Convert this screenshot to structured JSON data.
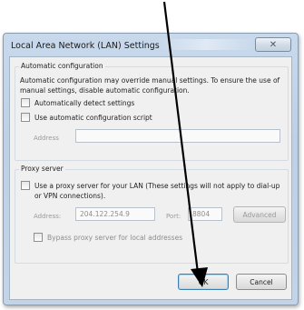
{
  "dialog": {
    "title": "Local Area Network (LAN) Settings",
    "close_symbol": "✕"
  },
  "auto_config": {
    "group_label": "Automatic configuration",
    "description": "Automatic configuration may override manual settings.  To ensure the use of manual settings, disable automatic configuration.",
    "detect_label": "Automatically detect settings",
    "script_label": "Use automatic configuration script",
    "address_label": "Address",
    "address_value": ""
  },
  "proxy": {
    "group_label": "Proxy server",
    "use_proxy_label": "Use a proxy server for your LAN (These settings will not apply to dial-up or VPN connections).",
    "address_label": "Address:",
    "address_value": "204.122.254.9",
    "port_label": "Port:",
    "port_value": "8804",
    "advanced_label": "Advanced",
    "bypass_label": "Bypass proxy server for local addresses"
  },
  "buttons": {
    "ok_label": "OK",
    "cancel_label": "Cancel"
  },
  "colors": {
    "arrow": "#000000",
    "title_bar": "#c3d4e8",
    "dialog_body": "#f0f0f0"
  }
}
